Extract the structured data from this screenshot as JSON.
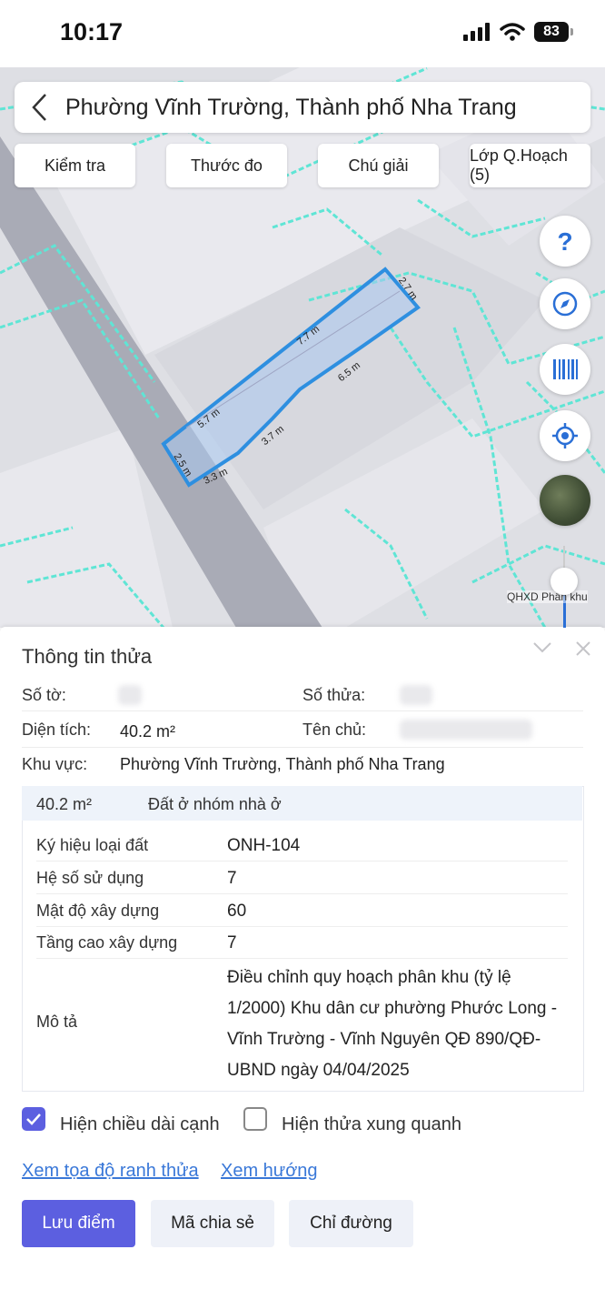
{
  "status": {
    "time": "10:17",
    "battery": "83"
  },
  "search": {
    "title": "Phường Vĩnh Trường, Thành phố Nha Trang"
  },
  "chips": [
    "Kiểm tra",
    "Thước đo",
    "Chú giải",
    "Lớp Q.Hoạch (5)"
  ],
  "map": {
    "edge_labels": [
      "2.7 m",
      "7.7 m",
      "6.5 m",
      "5.7 m",
      "3.7 m",
      "2.5 m",
      "3.3 m"
    ],
    "layer_label": "QHXD Phân khu",
    "colors": {
      "parcel": "#2e8fe0",
      "plan_lines": "#5fe5d5",
      "road": "#a9abb6"
    }
  },
  "panel": {
    "title": "Thông tin thửa",
    "so_to_label": "Số tờ:",
    "so_thua_label": "Số thửa:",
    "dien_tich_label": "Diện tích:",
    "dien_tich_value": "40.2 m²",
    "ten_chu_label": "Tên chủ:",
    "khu_vuc_label": "Khu vực:",
    "khu_vuc_value": "Phường Vĩnh Trường, Thành phố Nha Trang",
    "plan": {
      "area": "40.2 m²",
      "purpose": "Đất ở nhóm nhà ở",
      "rows": [
        {
          "label": "Ký hiệu loại đất",
          "value": "ONH-104"
        },
        {
          "label": "Hệ số sử dụng",
          "value": "7"
        },
        {
          "label": "Mật độ xây dựng",
          "value": "60"
        },
        {
          "label": "Tầng cao xây dựng",
          "value": "7"
        }
      ],
      "desc_label": "Mô tả",
      "desc_value": "Điều chỉnh quy hoạch phân khu (tỷ lệ 1/2000) Khu dân cư phường Phước Long - Vĩnh Trường - Vĩnh Nguyên QĐ 890/QĐ-UBND ngày 04/04/2025"
    },
    "show_edge_length": {
      "label": "Hiện chiều dài cạnh",
      "checked": true
    },
    "show_neighbors": {
      "label": "Hiện thửa xung quanh",
      "checked": false
    },
    "links": [
      "Xem tọa độ ranh thửa",
      "Xem hướng"
    ],
    "buttons": {
      "save": "Lưu điểm",
      "share": "Mã chia sẻ",
      "directions": "Chỉ đường"
    }
  }
}
